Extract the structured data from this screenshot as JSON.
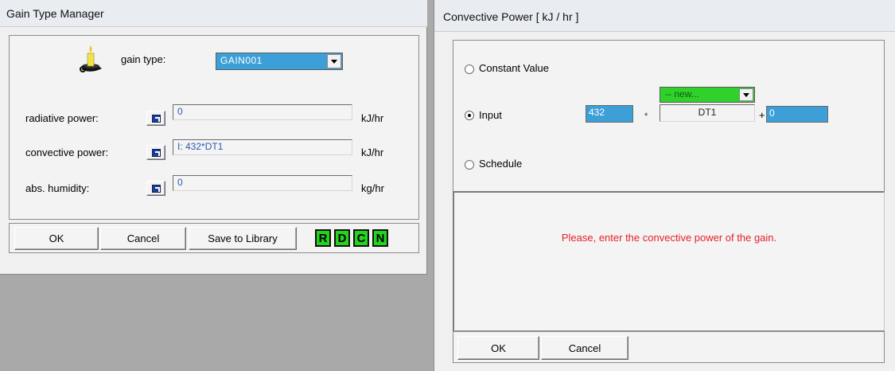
{
  "gain_manager": {
    "title": "Gain Type Manager",
    "gain_type_label": "gain type:",
    "gain_type_value": "GAIN001",
    "rows": [
      {
        "label": "radiative power:",
        "value": "0",
        "unit": "kJ/hr"
      },
      {
        "label": "convective power:",
        "value": "I: 432*DT1",
        "unit": "kJ/hr"
      },
      {
        "label": "abs. humidity:",
        "value": "0",
        "unit": "kg/hr"
      }
    ],
    "buttons": {
      "ok": "OK",
      "cancel": "Cancel",
      "save": "Save to Library"
    },
    "letter_buttons": [
      "R",
      "D",
      "C",
      "N"
    ],
    "colors": {
      "letter_button": "#22d41e",
      "combo": "#3c9fd8"
    }
  },
  "convective": {
    "title": "Convective Power  [ kJ / hr ]",
    "options": {
      "constant": "Constant Value",
      "input": "Input",
      "schedule": "Schedule"
    },
    "selected": "Input",
    "factor": "432",
    "multiply": "*",
    "variable_select": "-- new...",
    "variable_name": "DT1",
    "plus": "+",
    "offset": "0",
    "message": "Please, enter the convective power of the gain.",
    "buttons": {
      "ok": "OK",
      "cancel": "Cancel"
    },
    "colors": {
      "message": "#e8202b",
      "select": "#2fd12a",
      "field": "#3c9fd8"
    }
  }
}
